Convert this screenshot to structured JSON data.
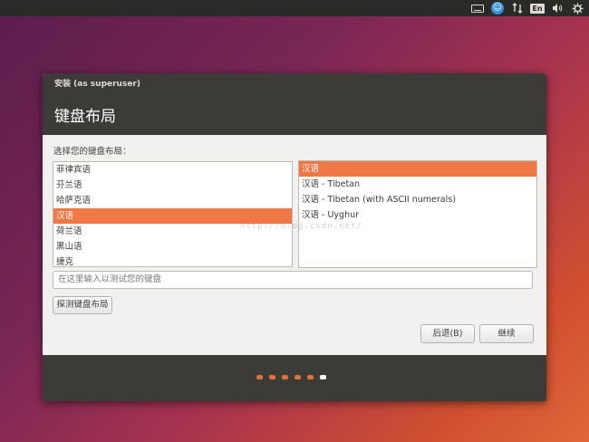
{
  "top_panel": {
    "input_method": "En",
    "icons": [
      "keyboard-icon",
      "accessibility-icon",
      "network-icon",
      "input-method-icon",
      "volume-icon",
      "settings-icon"
    ]
  },
  "window": {
    "title": "安装 (as superuser)",
    "page_title": "键盘布局",
    "prompt": "选择您的键盘布局：",
    "layouts": [
      "菲律宾语",
      "芬兰语",
      "哈萨克语",
      "汉语",
      "荷兰语",
      "黑山语",
      "捷克"
    ],
    "selected_layout": "汉语",
    "variants": [
      "汉语",
      "汉语 - Tibetan",
      "汉语 - Tibetan (with ASCII numerals)",
      "汉语 - Uyghur"
    ],
    "selected_variant": "汉语",
    "search_placeholder": "在这里输入以测试您的键盘",
    "detect_button": "探测键盘布局",
    "back_button": "后退(B)",
    "continue_button": "继续",
    "progress": {
      "total_steps": 6,
      "current_step": 6
    }
  },
  "watermark": "http://blog.csdn.net/",
  "colors": {
    "accent": "#f07746",
    "titlebar": "#3c3b37",
    "panel": "#2a2a28"
  }
}
